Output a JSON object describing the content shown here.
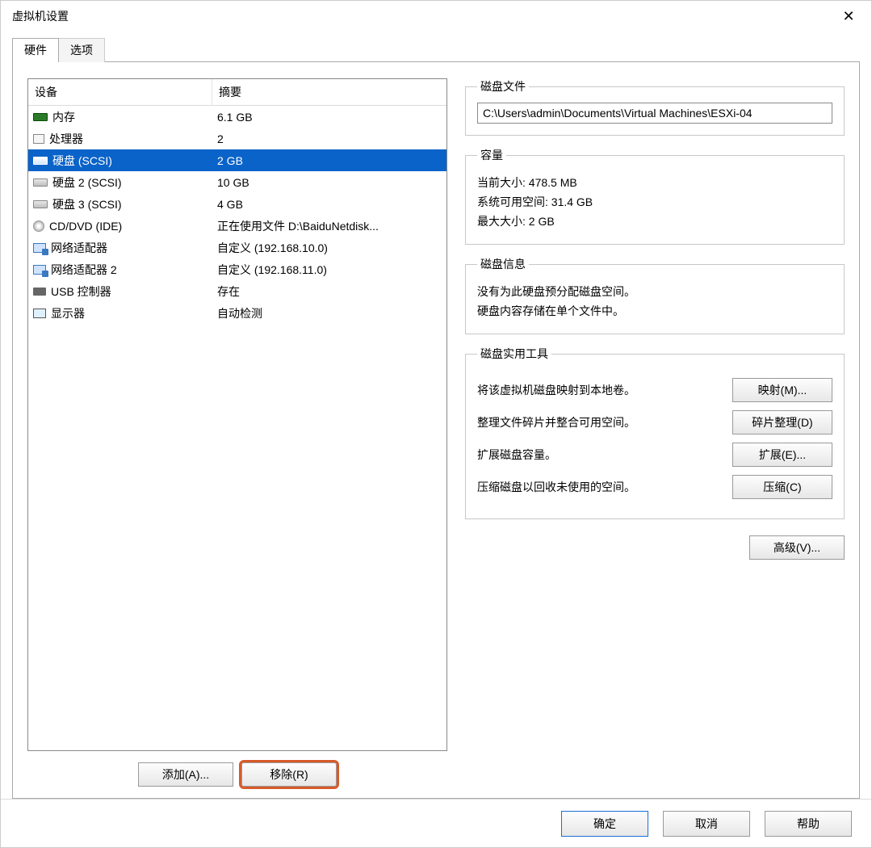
{
  "window": {
    "title": "虚拟机设置"
  },
  "tabs": {
    "hardware": "硬件",
    "options": "选项"
  },
  "device_list": {
    "header": {
      "device": "设备",
      "summary": "摘要"
    },
    "rows": [
      {
        "name": "内存",
        "summary": "6.1 GB",
        "icon": "memory-icon"
      },
      {
        "name": "处理器",
        "summary": "2",
        "icon": "cpu-icon"
      },
      {
        "name": "硬盘 (SCSI)",
        "summary": "2 GB",
        "icon": "disk-icon",
        "selected": true
      },
      {
        "name": "硬盘 2 (SCSI)",
        "summary": "10 GB",
        "icon": "disk-icon"
      },
      {
        "name": "硬盘 3 (SCSI)",
        "summary": "4 GB",
        "icon": "disk-icon"
      },
      {
        "name": "CD/DVD (IDE)",
        "summary": "正在使用文件 D:\\BaiduNetdisk...",
        "icon": "cd-icon"
      },
      {
        "name": "网络适配器",
        "summary": "自定义 (192.168.10.0)",
        "icon": "network-icon"
      },
      {
        "name": "网络适配器 2",
        "summary": "自定义 (192.168.11.0)",
        "icon": "network-icon"
      },
      {
        "name": "USB 控制器",
        "summary": "存在",
        "icon": "usb-icon"
      },
      {
        "name": "显示器",
        "summary": "自动检测",
        "icon": "display-icon"
      }
    ]
  },
  "left_buttons": {
    "add": "添加(A)...",
    "remove": "移除(R)"
  },
  "right": {
    "diskfile": {
      "legend": "磁盘文件",
      "path": "C:\\Users\\admin\\Documents\\Virtual Machines\\ESXi-04"
    },
    "capacity": {
      "legend": "容量",
      "current": "当前大小: 478.5 MB",
      "free": "系统可用空间: 31.4 GB",
      "max": "最大大小: 2 GB"
    },
    "diskinfo": {
      "legend": "磁盘信息",
      "line1": "没有为此硬盘预分配磁盘空间。",
      "line2": "硬盘内容存储在单个文件中。"
    },
    "utils": {
      "legend": "磁盘实用工具",
      "map": {
        "desc": "将该虚拟机磁盘映射到本地卷。",
        "btn": "映射(M)..."
      },
      "defrag": {
        "desc": "整理文件碎片并整合可用空间。",
        "btn": "碎片整理(D)"
      },
      "expand": {
        "desc": "扩展磁盘容量。",
        "btn": "扩展(E)..."
      },
      "compact": {
        "desc": "压缩磁盘以回收未使用的空间。",
        "btn": "压缩(C)"
      }
    },
    "advanced": "高级(V)..."
  },
  "bottom": {
    "ok": "确定",
    "cancel": "取消",
    "help": "帮助"
  }
}
